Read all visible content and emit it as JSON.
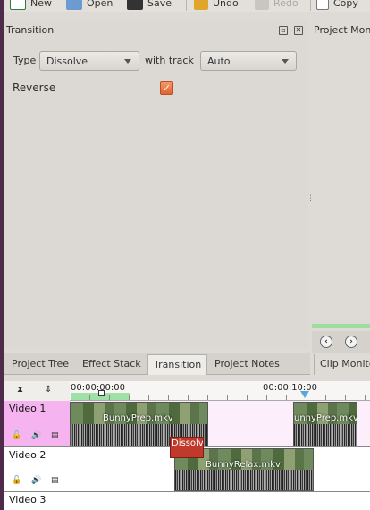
{
  "toolbar": {
    "new_label": "New",
    "open_label": "Open",
    "save_label": "Save",
    "undo_label": "Undo",
    "redo_label": "Redo",
    "copy_label": "Copy"
  },
  "transition_panel": {
    "title": "Transition",
    "type_label": "Type",
    "type_value": "Dissolve",
    "with_track_label": "with track",
    "track_value": "Auto",
    "reverse_label": "Reverse",
    "reverse_checked": "✓"
  },
  "project_monitor": {
    "title": "Project Mon"
  },
  "tabs": [
    {
      "label": "Project Tree"
    },
    {
      "label": "Effect Stack"
    },
    {
      "label": "Transition"
    },
    {
      "label": "Project Notes"
    }
  ],
  "clip_monitor_tab": "Clip Monito",
  "timeline": {
    "timecodes": [
      "00:00:00:00",
      "00:00:10:00"
    ],
    "tracks": [
      {
        "name": "Video 1"
      },
      {
        "name": "Video 2"
      },
      {
        "name": "Video 3"
      }
    ],
    "clips": [
      {
        "label": "BunnyPrep.mkv"
      },
      {
        "label": "unnyPrep.mkv"
      },
      {
        "label": "BunnyRelax.mkv"
      }
    ],
    "transition_label": "Dissolve"
  },
  "colors": {
    "accent": "#e0642f",
    "track_active": "#f5b3ef",
    "zone": "#9ee0a6",
    "transition": "#c0392b"
  }
}
